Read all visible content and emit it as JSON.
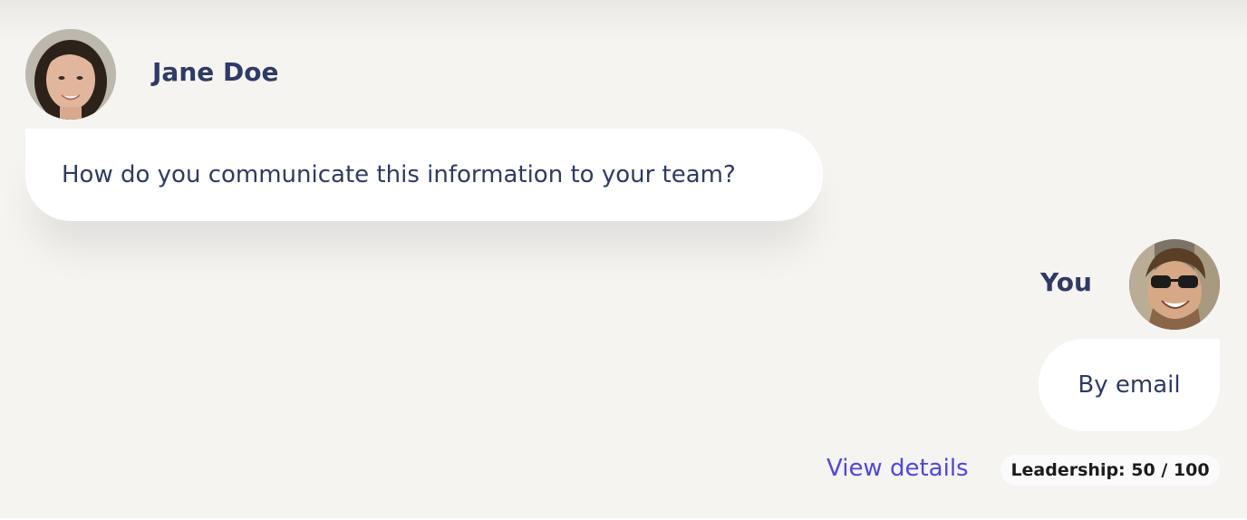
{
  "conversation": {
    "messages": [
      {
        "sender": "Jane Doe",
        "avatar_icon": "avatar-woman-photo",
        "text": "How do you communicate this information to your team?"
      },
      {
        "sender": "You",
        "avatar_icon": "avatar-man-sunglasses-photo",
        "text": "By email"
      }
    ]
  },
  "footer": {
    "view_details_label": "View details",
    "score_badge": "Leadership: 50 / 100"
  },
  "colors": {
    "background": "#f5f4f1",
    "text_primary": "#2f3a66",
    "link": "#5145e5",
    "bubble": "#ffffff"
  }
}
